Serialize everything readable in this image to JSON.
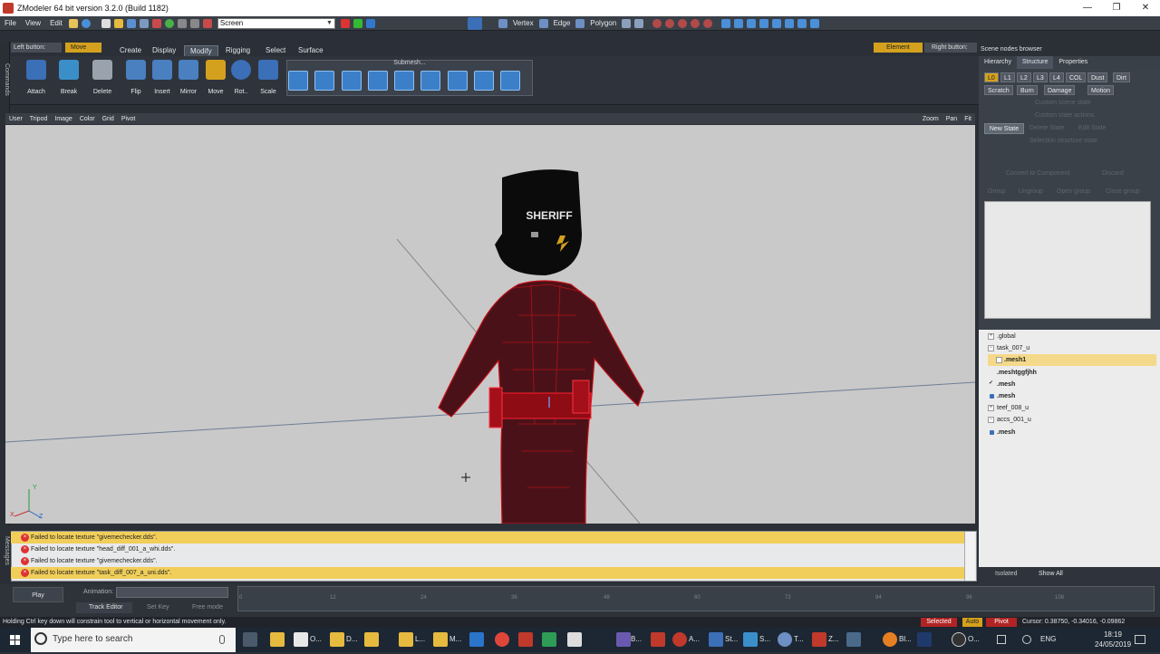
{
  "window": {
    "title": "ZModeler 64 bit version 3.2.0 (Build 1182)",
    "controls": [
      "—",
      "❐",
      "✕"
    ]
  },
  "menu": [
    "File",
    "View",
    "Edit"
  ],
  "screen_select": "Screen",
  "modes": {
    "vertex": "Vertex",
    "edge": "Edge",
    "polygon": "Polygon"
  },
  "left_button": "Left button:",
  "left_button_mode": "Move",
  "tabs": [
    "Create",
    "Display",
    "Modify",
    "Rigging",
    "Select",
    "Surface"
  ],
  "active_tab": "Modify",
  "tools": [
    "Attach",
    "Break",
    "Delete",
    "Flip",
    "Insert",
    "Mirror",
    "Move",
    "Rot..",
    "Scale"
  ],
  "active_tool": "Move",
  "submesh_label": "Submesh...",
  "viewport_header": {
    "items": [
      "User",
      "Tripod",
      "Image",
      "Color",
      "Grid",
      "Pivot"
    ],
    "right": [
      "Zoom",
      "Pan",
      "Fit"
    ]
  },
  "model_text": "SHERIFF",
  "messages": [
    {
      "text": "Failed to locate texture \"givemechecker.dds\".",
      "highlight": true
    },
    {
      "text": "Failed to locate texture \"head_diff_001_a_whi.dds\".",
      "highlight": false
    },
    {
      "text": "Failed to locate texture \"givemechecker.dds\".",
      "highlight": false
    },
    {
      "text": "Failed to locate texture \"task_diff_007_a_uni.dds\".",
      "highlight": true
    }
  ],
  "left_rail": {
    "commands": "Commands",
    "messages": "Messages"
  },
  "animation": {
    "play": "Play",
    "label": "Animation:",
    "track_editor": "Track Editor",
    "set_key": "Set Key",
    "free_mode": "Free mode",
    "ticks": [
      "0",
      "12",
      "24",
      "36",
      "48",
      "60",
      "72",
      "84",
      "96",
      "108"
    ]
  },
  "status": {
    "text": "Holding Ctrl key down will constrain tool to vertical or horizontal movement only.",
    "selected": "Selected",
    "auto": "Auto",
    "pivot": "Pivot",
    "cursor": "Cursor: 0.38750, -0.34016, -0.09862"
  },
  "right_panel": {
    "element": "Element",
    "right_button": "Right button:",
    "header": "Scene nodes browser",
    "tabs": [
      "Hierarchy",
      "Structure",
      "Properties"
    ],
    "active_tab": "Structure",
    "lods": [
      "L0",
      "L1",
      "L2",
      "L3",
      "L4",
      "COL",
      "Dust",
      "Dirt"
    ],
    "dropdowns": [
      "Scratch",
      "Burn",
      "Damage",
      "Motion"
    ],
    "new_state": "New State",
    "ghost": [
      "Custom scene state",
      "Custom state actions",
      "Delete State",
      "Edit State",
      "Selection structure state",
      "Convert to Component",
      "Discard",
      "Group",
      "Ungroup",
      "Open group",
      "Close group"
    ]
  },
  "scene_nodes": [
    {
      "name": ".global",
      "indent": 0,
      "kind": "toggle",
      "bold": false,
      "selected": false
    },
    {
      "name": "task_007_u",
      "indent": 0,
      "kind": "toggle",
      "bold": false,
      "selected": false
    },
    {
      "name": ".mesh1",
      "indent": 1,
      "kind": "box",
      "bold": true,
      "selected": true
    },
    {
      "name": ".meshtggfjhh",
      "indent": 0,
      "kind": "none",
      "bold": true,
      "selected": false
    },
    {
      "name": ".mesh",
      "indent": 0,
      "kind": "check",
      "bold": true,
      "selected": false
    },
    {
      "name": ".mesh",
      "indent": 0,
      "kind": "dot",
      "bold": true,
      "selected": false
    },
    {
      "name": "teef_008_u",
      "indent": 0,
      "kind": "toggle",
      "bold": false,
      "selected": false
    },
    {
      "name": "accs_001_u",
      "indent": 0,
      "kind": "toggle",
      "bold": false,
      "selected": false
    },
    {
      "name": ".mesh",
      "indent": 0,
      "kind": "dot",
      "bold": true,
      "selected": false
    }
  ],
  "node_bottom": {
    "isolated": "Isolated",
    "show_all": "Show All"
  },
  "taskbar": {
    "search_placeholder": "Type here to search",
    "apps": [
      "O...",
      "D...",
      "L...",
      "M...",
      "B...",
      "A...",
      "St...",
      "S...",
      "T...",
      "Z...",
      "Bl...",
      "O..."
    ],
    "lang": "ENG",
    "time": "18:19",
    "date": "24/05/2019"
  }
}
